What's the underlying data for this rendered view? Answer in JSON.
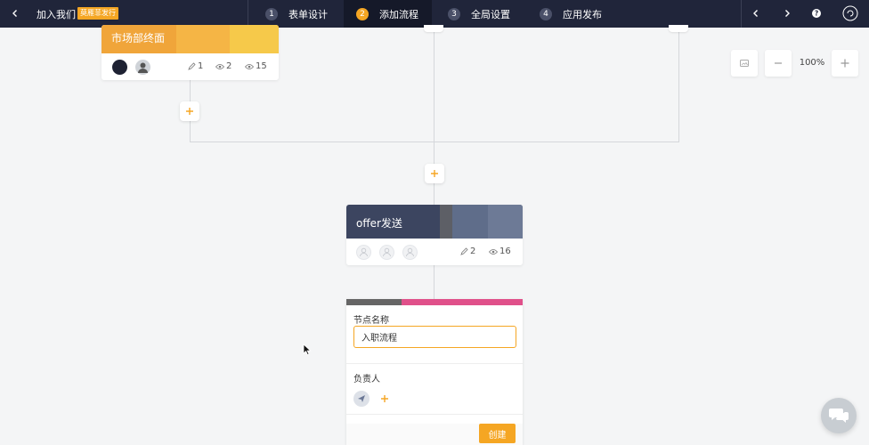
{
  "topbar": {
    "title": "加入我们",
    "badge": "莫雁菲发行",
    "steps": [
      {
        "num": "1",
        "label": "表单设计"
      },
      {
        "num": "2",
        "label": "添加流程"
      },
      {
        "num": "3",
        "label": "全局设置"
      },
      {
        "num": "4",
        "label": "应用发布"
      }
    ],
    "active_step": 2
  },
  "nodes": [
    {
      "title": "市场部终面",
      "edits": "1",
      "views": "2",
      "count": "15"
    },
    {
      "title": "offer发送",
      "edits": "2",
      "views": "16"
    }
  ],
  "zoom": {
    "level": "100%"
  },
  "editor": {
    "name_label": "节点名称",
    "name_value": "入职流程",
    "owner_label": "负责人",
    "create_label": "创建"
  },
  "colors": {
    "accent": "#f5a623",
    "topbar": "#20253a",
    "pink": "#e0508a"
  }
}
